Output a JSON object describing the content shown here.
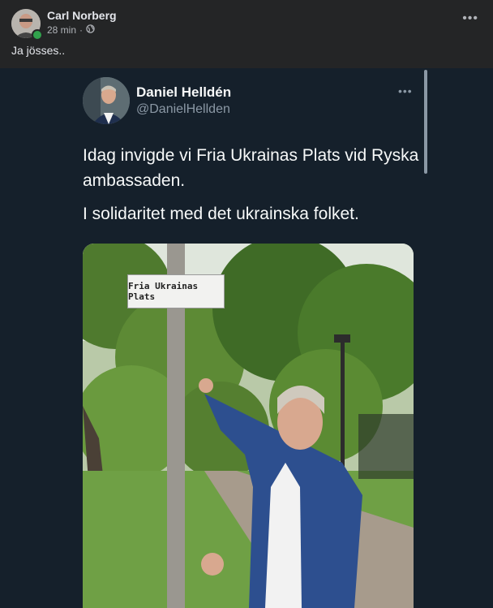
{
  "post": {
    "author": "Carl Norberg",
    "time": "28 min",
    "dot": "·",
    "text": "Ja jösses..",
    "more": "•••"
  },
  "tweet": {
    "name": "Daniel Helldén",
    "handle": "@DanielHellden",
    "more": "•••",
    "paragraphs": [
      "Idag invigde vi Fria Ukrainas Plats vid Ryska ambassaden.",
      "I solidaritet med det ukrainska folket."
    ],
    "image": {
      "sign_text": "Fria Ukrainas Plats"
    }
  },
  "colors": {
    "fb_background": "#242526",
    "tweet_background": "#15202b",
    "online_green": "#31a24c"
  },
  "icons": [
    "globe-icon",
    "more-horizontal-icon",
    "online-status-icon"
  ]
}
